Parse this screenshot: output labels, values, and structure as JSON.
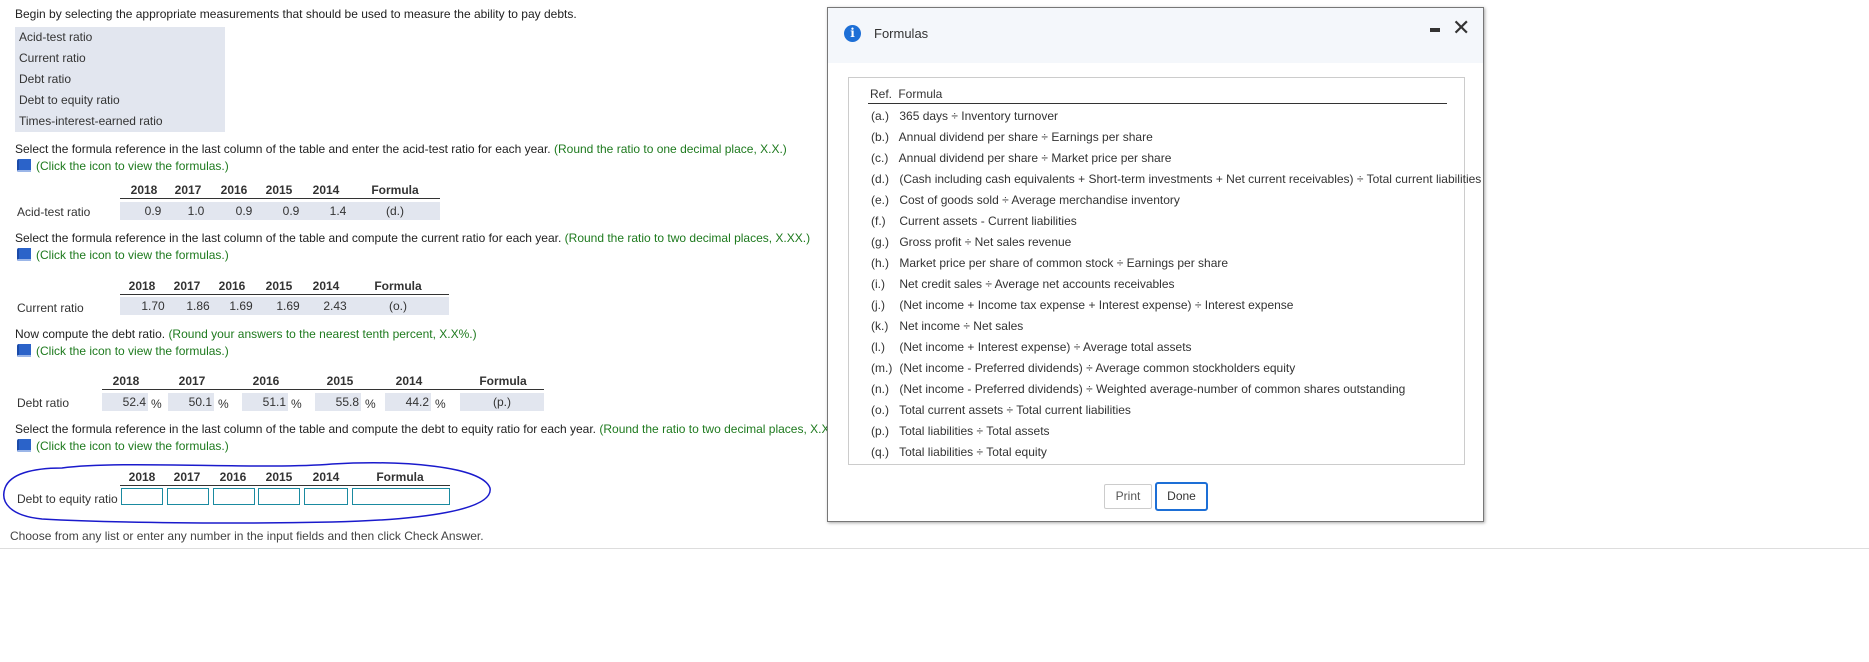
{
  "instructions": {
    "intro": "Begin by selecting the appropriate measurements that should be used to measure the ability to pay debts.",
    "q1_text": "Select the formula reference in the last column of the table and enter the acid-test ratio for each year.",
    "q1_hint": "(Round the ratio to one decimal place, X.X.)",
    "q2_text": "Select the formula reference in the last column of the table and compute the current ratio for each year.",
    "q2_hint": "(Round the ratio to two decimal places, X.XX.)",
    "q3_text": "Now compute the debt ratio.",
    "q3_hint": "(Round your answers to the nearest tenth percent, X.X%.)",
    "q4_text": "Select the formula reference in the last column of the table and compute the debt to equity ratio for each year.",
    "q4_hint": "(Round the ratio to two decimal places, X.XX.)",
    "formula_link": "(Click the icon to view the formulas.)",
    "footer": "Choose from any list or enter any number in the input fields and then click Check Answer."
  },
  "measurements": [
    "Acid-test ratio",
    "Current ratio",
    "Debt ratio",
    "Debt to equity ratio",
    "Times-interest-earned ratio"
  ],
  "table_headers": {
    "years": [
      "2018",
      "2017",
      "2016",
      "2015",
      "2014"
    ],
    "formula": "Formula"
  },
  "acid_test": {
    "label": "Acid-test ratio",
    "values": [
      "0.9",
      "1.0",
      "0.9",
      "0.9",
      "1.4"
    ],
    "formula": "(d.)"
  },
  "current": {
    "label": "Current ratio",
    "values": [
      "1.70",
      "1.86",
      "1.69",
      "1.69",
      "2.43"
    ],
    "formula": "(o.)"
  },
  "debt": {
    "label": "Debt ratio",
    "values": [
      "52.4",
      "50.1",
      "51.1",
      "55.8",
      "44.2"
    ],
    "unit": "%",
    "formula": "(p.)"
  },
  "debt_equity": {
    "label": "Debt to equity ratio"
  },
  "dialog": {
    "title": "Formulas",
    "col_ref": "Ref.",
    "col_formula": "Formula",
    "formulas": [
      {
        "ref": "(a.)",
        "text": "365 days ÷ Inventory turnover"
      },
      {
        "ref": "(b.)",
        "text": "Annual dividend per share ÷ Earnings per share"
      },
      {
        "ref": "(c.)",
        "text": "Annual dividend per share ÷ Market price per share"
      },
      {
        "ref": "(d.)",
        "text": "(Cash including cash equivalents + Short-term investments + Net current receivables) ÷ Total current liabilities"
      },
      {
        "ref": "(e.)",
        "text": "Cost of goods sold ÷ Average merchandise inventory"
      },
      {
        "ref": "(f.)",
        "text": "Current assets - Current liabilities"
      },
      {
        "ref": "(g.)",
        "text": "Gross profit ÷ Net sales revenue"
      },
      {
        "ref": "(h.)",
        "text": "Market price per share of common stock ÷ Earnings per share"
      },
      {
        "ref": "(i.)",
        "text": "Net credit sales ÷ Average net accounts receivables"
      },
      {
        "ref": "(j.)",
        "text": "(Net income + Income tax expense + Interest expense) ÷ Interest expense"
      },
      {
        "ref": "(k.)",
        "text": "Net income ÷ Net sales"
      },
      {
        "ref": "(l.)",
        "text": "(Net income + Interest expense) ÷ Average total assets"
      },
      {
        "ref": "(m.)",
        "text": "(Net income - Preferred dividends) ÷ Average common stockholders equity"
      },
      {
        "ref": "(n.)",
        "text": "(Net income - Preferred dividends) ÷ Weighted average-number of common shares outstanding"
      },
      {
        "ref": "(o.)",
        "text": "Total current assets ÷ Total current liabilities"
      },
      {
        "ref": "(p.)",
        "text": "Total liabilities ÷ Total assets"
      },
      {
        "ref": "(q.)",
        "text": "Total liabilities ÷ Total equity"
      }
    ],
    "print_label": "Print",
    "done_label": "Done"
  },
  "colors": {
    "accent": "#1d6fd6",
    "hint_green": "#1e7a1e",
    "cell_bg": "#e2e6ef",
    "annotation": "#1a1acc"
  }
}
